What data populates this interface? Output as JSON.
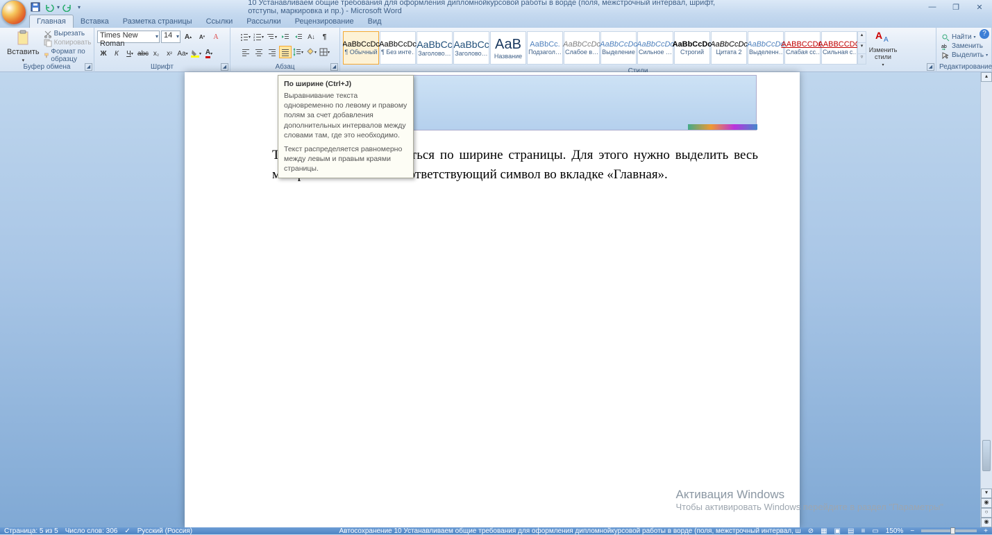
{
  "title": "10 Устанавливаем общие требования для оформления дипломнойкурсовой работы в ворде (поля, межстрочный интервал, шрифт, отступы, маркировка и пр.)  -  Microsoft Word",
  "qat": {
    "save": "💾",
    "undo": "↶",
    "redo": "↷"
  },
  "tabs": [
    "Главная",
    "Вставка",
    "Разметка страницы",
    "Ссылки",
    "Рассылки",
    "Рецензирование",
    "Вид"
  ],
  "clipboard": {
    "paste": "Вставить",
    "cut": "Вырезать",
    "copy": "Копировать",
    "format": "Формат по образцу",
    "group": "Буфер обмена"
  },
  "font": {
    "name": "Times New Roman",
    "size": "14",
    "group": "Шрифт"
  },
  "paragraph": {
    "group": "Абзац"
  },
  "tooltip": {
    "title": "По ширине (Ctrl+J)",
    "body1": "Выравнивание текста одновременно по левому и правому полям за счет добавления дополнительных интервалов между словами там, где это необходимо.",
    "body2": "Текст распределяется равномерно между левым и правым краями страницы."
  },
  "styles_group": "Стили",
  "change_styles": "Изменить стили",
  "styles": [
    {
      "preview": "AaBbCcDc",
      "name": "¶ Обычный",
      "col": "#000",
      "sel": true
    },
    {
      "preview": "AaBbCcDc",
      "name": "¶ Без инте…",
      "col": "#000"
    },
    {
      "preview": "AaBbCc",
      "name": "Заголово…",
      "col": "#1f4e79",
      "big": 1
    },
    {
      "preview": "AaBbCc",
      "name": "Заголово…",
      "col": "#1f4e79",
      "big": 1
    },
    {
      "preview": "АаВ",
      "name": "Название",
      "col": "#17365d",
      "huge": 1
    },
    {
      "preview": "AaBbCc.",
      "name": "Подзагол…",
      "col": "#4f81bd"
    },
    {
      "preview": "AaBbCcDc",
      "name": "Слабое в…",
      "col": "#808080",
      "ital": 1
    },
    {
      "preview": "AaBbCcDc",
      "name": "Выделение",
      "col": "#4f81bd",
      "ital": 1
    },
    {
      "preview": "AaBbCcDc",
      "name": "Сильное …",
      "col": "#4f81bd",
      "ital": 1
    },
    {
      "preview": "AaBbCcDc",
      "name": "Строгий",
      "col": "#000",
      "bold": 1
    },
    {
      "preview": "AaBbCcDc",
      "name": "Цитата 2",
      "col": "#000",
      "ital": 1
    },
    {
      "preview": "AaBbCcDc",
      "name": "Выделенн…",
      "col": "#4f81bd",
      "ital": 1
    },
    {
      "preview": "AABBCCDC",
      "name": "Слабая сс…",
      "col": "#c00000",
      "ul": 1
    },
    {
      "preview": "AABBCCDC",
      "name": "Сильная с…",
      "col": "#c00000",
      "ul": 1
    }
  ],
  "editing": {
    "find": "Найти",
    "replace": "Заменить",
    "select": "Выделить",
    "group": "Редактирование"
  },
  "doc_text": "Текст должен располагаться по ширине страницы. Для этого нужно выделить весь материал и нажать на соответствующий символ во вкладке «Главная».",
  "watermark": {
    "title": "Активация Windows",
    "body": "Чтобы активировать Windows перейдите в раздел \"Параметры\""
  },
  "status": {
    "page": "Страница: 5 из 5",
    "words": "Число слов: 306",
    "lang": "Русский (Россия)",
    "autosave": "Автосохранение 10 Устанавливаем общие требования для оформления дипломнойкурсовой работы в ворде (поля, межстрочный интервал, ш",
    "zoom": "150%"
  }
}
